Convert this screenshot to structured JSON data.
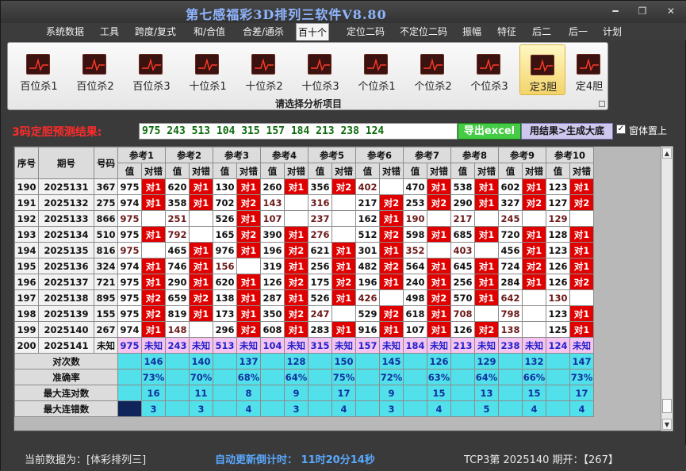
{
  "window": {
    "title": "第七感福彩3D排列三软件V8.80",
    "min": "━",
    "restore": "❐",
    "close": "✕"
  },
  "menu": [
    "系统数据",
    "工具",
    "跨度/复式",
    "和/合值",
    "合差/通杀",
    "百十个",
    "定位二码",
    "不定位二码",
    "振幅",
    "特征",
    "后二",
    "后一",
    "计划"
  ],
  "ribbon": {
    "buttons": [
      "百位杀1",
      "百位杀2",
      "百位杀3",
      "十位杀1",
      "十位杀2",
      "十位杀3",
      "个位杀1",
      "个位杀2",
      "个位杀3",
      "定3胆",
      "定4胆"
    ],
    "caption": "请选择分析项目"
  },
  "result": {
    "label": "3码定胆预测结果:",
    "value": "975 243 513 104 315 157 184 213 238 124",
    "excel_btn": "导出excel",
    "gen_btn": "用结果>生成大底",
    "pin_label": "窗体置上",
    "pin_checked": "✓"
  },
  "table": {
    "col_serial": "序号",
    "col_issue": "期号",
    "col_num": "号码",
    "refs": [
      "参考1",
      "参考2",
      "参考3",
      "参考4",
      "参考5",
      "参考6",
      "参考7",
      "参考8",
      "参考9",
      "参考10"
    ],
    "sub_val": "值",
    "sub_hit": "对错",
    "rows": [
      {
        "serial": "190",
        "issue": "2025131",
        "num": "367",
        "cells": [
          [
            "975",
            "对1"
          ],
          [
            "620",
            "对1"
          ],
          [
            "130",
            "对1"
          ],
          [
            "260",
            "对1"
          ],
          [
            "356",
            "对2"
          ],
          [
            "402",
            ""
          ],
          [
            "470",
            "对1"
          ],
          [
            "538",
            "对1"
          ],
          [
            "602",
            "对1"
          ],
          [
            "123",
            "对1"
          ]
        ]
      },
      {
        "serial": "191",
        "issue": "2025132",
        "num": "275",
        "cells": [
          [
            "974",
            "对1"
          ],
          [
            "358",
            "对1"
          ],
          [
            "702",
            "对2"
          ],
          [
            "143",
            ""
          ],
          [
            "316",
            ""
          ],
          [
            "217",
            "对2"
          ],
          [
            "253",
            "对2"
          ],
          [
            "290",
            "对1"
          ],
          [
            "327",
            "对2"
          ],
          [
            "127",
            "对2"
          ]
        ]
      },
      {
        "serial": "192",
        "issue": "2025133",
        "num": "866",
        "cells": [
          [
            "975",
            ""
          ],
          [
            "251",
            ""
          ],
          [
            "526",
            "对1"
          ],
          [
            "107",
            ""
          ],
          [
            "237",
            ""
          ],
          [
            "162",
            "对1"
          ],
          [
            "190",
            ""
          ],
          [
            "217",
            ""
          ],
          [
            "245",
            ""
          ],
          [
            "129",
            ""
          ]
        ]
      },
      {
        "serial": "193",
        "issue": "2025134",
        "num": "510",
        "cells": [
          [
            "975",
            "对1"
          ],
          [
            "792",
            ""
          ],
          [
            "165",
            "对2"
          ],
          [
            "390",
            "对1"
          ],
          [
            "276",
            ""
          ],
          [
            "512",
            "对2"
          ],
          [
            "598",
            "对1"
          ],
          [
            "685",
            "对1"
          ],
          [
            "720",
            "对1"
          ],
          [
            "128",
            "对1"
          ]
        ]
      },
      {
        "serial": "194",
        "issue": "2025135",
        "num": "816",
        "cells": [
          [
            "975",
            ""
          ],
          [
            "465",
            "对1"
          ],
          [
            "976",
            "对1"
          ],
          [
            "196",
            "对2"
          ],
          [
            "621",
            "对1"
          ],
          [
            "301",
            "对1"
          ],
          [
            "352",
            ""
          ],
          [
            "403",
            ""
          ],
          [
            "456",
            "对1"
          ],
          [
            "123",
            "对1"
          ]
        ]
      },
      {
        "serial": "195",
        "issue": "2025136",
        "num": "324",
        "cells": [
          [
            "974",
            "对1"
          ],
          [
            "746",
            "对1"
          ],
          [
            "156",
            ""
          ],
          [
            "319",
            "对1"
          ],
          [
            "256",
            "对1"
          ],
          [
            "482",
            "对2"
          ],
          [
            "564",
            "对1"
          ],
          [
            "645",
            "对1"
          ],
          [
            "724",
            "对2"
          ],
          [
            "126",
            "对1"
          ]
        ]
      },
      {
        "serial": "196",
        "issue": "2025137",
        "num": "721",
        "cells": [
          [
            "975",
            "对1"
          ],
          [
            "290",
            "对1"
          ],
          [
            "620",
            "对1"
          ],
          [
            "126",
            "对2"
          ],
          [
            "175",
            "对2"
          ],
          [
            "196",
            "对1"
          ],
          [
            "240",
            "对1"
          ],
          [
            "256",
            "对1"
          ],
          [
            "284",
            "对1"
          ],
          [
            "126",
            "对2"
          ]
        ]
      },
      {
        "serial": "197",
        "issue": "2025138",
        "num": "895",
        "cells": [
          [
            "975",
            "对2"
          ],
          [
            "659",
            "对2"
          ],
          [
            "138",
            "对1"
          ],
          [
            "287",
            "对1"
          ],
          [
            "526",
            "对1"
          ],
          [
            "426",
            ""
          ],
          [
            "498",
            "对2"
          ],
          [
            "570",
            "对1"
          ],
          [
            "642",
            ""
          ],
          [
            "130",
            ""
          ]
        ]
      },
      {
        "serial": "198",
        "issue": "2025139",
        "num": "155",
        "cells": [
          [
            "975",
            "对2"
          ],
          [
            "819",
            "对1"
          ],
          [
            "173",
            "对1"
          ],
          [
            "350",
            "对2"
          ],
          [
            "247",
            ""
          ],
          [
            "529",
            "对2"
          ],
          [
            "618",
            "对1"
          ],
          [
            "708",
            ""
          ],
          [
            "798",
            ""
          ],
          [
            "123",
            "对1"
          ]
        ]
      },
      {
        "serial": "199",
        "issue": "2025140",
        "num": "267",
        "cells": [
          [
            "974",
            "对1"
          ],
          [
            "148",
            ""
          ],
          [
            "296",
            "对2"
          ],
          [
            "608",
            "对1"
          ],
          [
            "283",
            "对1"
          ],
          [
            "916",
            "对1"
          ],
          [
            "107",
            "对1"
          ],
          [
            "126",
            "对2"
          ],
          [
            "138",
            ""
          ],
          [
            "125",
            "对1"
          ]
        ]
      },
      {
        "serial": "200",
        "issue": "2025141",
        "num": "未知",
        "cells": [
          [
            "975",
            "未知"
          ],
          [
            "243",
            "未知"
          ],
          [
            "513",
            "未知"
          ],
          [
            "104",
            "未知"
          ],
          [
            "315",
            "未知"
          ],
          [
            "157",
            "未知"
          ],
          [
            "184",
            "未知"
          ],
          [
            "213",
            "未知"
          ],
          [
            "238",
            "未知"
          ],
          [
            "124",
            "未知"
          ]
        ]
      }
    ],
    "stats": [
      {
        "label": "对次数",
        "values": [
          "146",
          "140",
          "137",
          "128",
          "150",
          "145",
          "126",
          "129",
          "132",
          "147"
        ]
      },
      {
        "label": "准确率",
        "values": [
          "73%",
          "70%",
          "68%",
          "64%",
          "75%",
          "72%",
          "63%",
          "64%",
          "66%",
          "73%"
        ]
      },
      {
        "label": "最大连对数",
        "values": [
          "16",
          "11",
          "8",
          "9",
          "17",
          "9",
          "15",
          "13",
          "15",
          "17"
        ]
      },
      {
        "label": "最大连错数",
        "values": [
          "3",
          "3",
          "4",
          "3",
          "4",
          "3",
          "4",
          "5",
          "4",
          "4"
        ]
      }
    ]
  },
  "status": {
    "current": "当前数据为：[体彩排列三]",
    "countdown": "自动更新倒计时：  11时20分14秒",
    "period": "TCP3第 2025140 期开：【267】"
  },
  "colors": {
    "hit": "#e00000",
    "stats": "#52e0ea",
    "latest": "#f6c4f0",
    "accent": "#8fb6ff"
  }
}
